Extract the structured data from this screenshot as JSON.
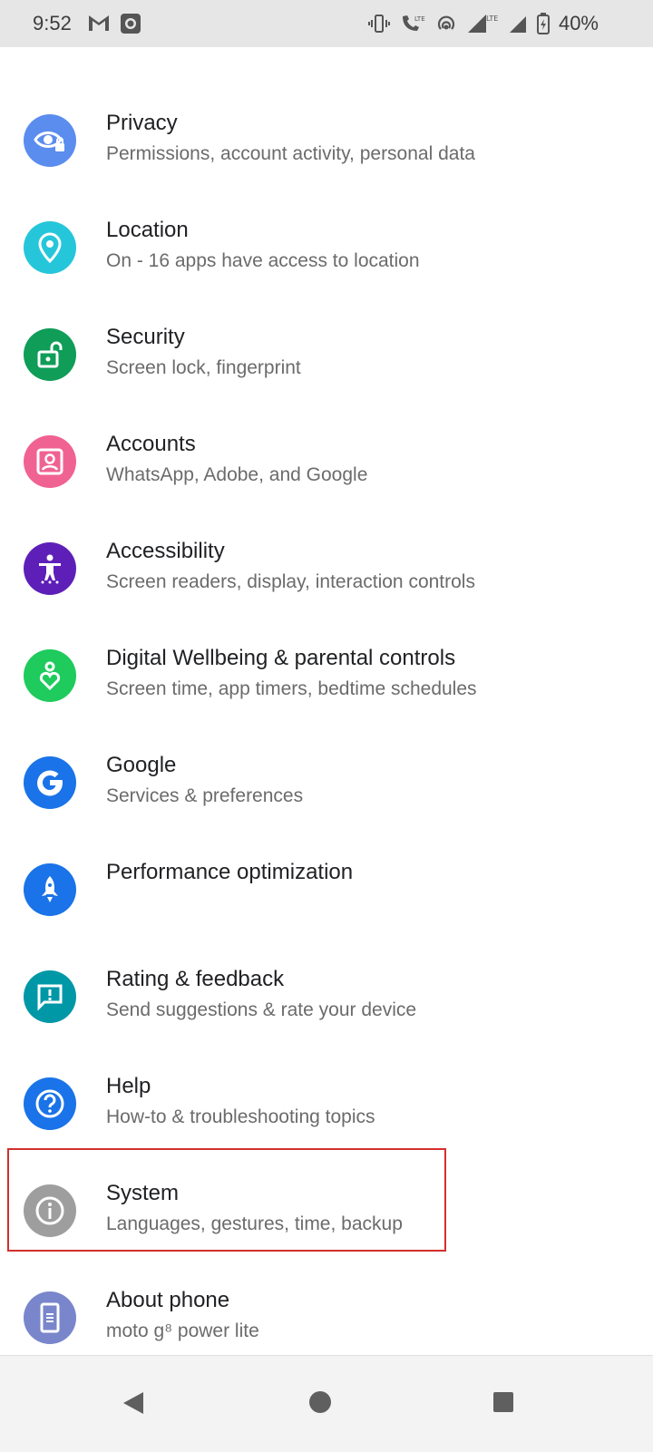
{
  "status_bar": {
    "time": "9:52",
    "battery": "40%"
  },
  "settings": [
    {
      "title": "Privacy",
      "subtitle": "Permissions, account activity, personal data",
      "icon": "privacy-eye-icon",
      "color": "#5b8def"
    },
    {
      "title": "Location",
      "subtitle": "On - 16 apps have access to location",
      "icon": "location-pin-icon",
      "color": "#26c6da"
    },
    {
      "title": "Security",
      "subtitle": "Screen lock, fingerprint",
      "icon": "lock-open-icon",
      "color": "#0f9d58"
    },
    {
      "title": "Accounts",
      "subtitle": "WhatsApp, Adobe, and Google",
      "icon": "account-box-icon",
      "color": "#f06292"
    },
    {
      "title": "Accessibility",
      "subtitle": "Screen readers, display, interaction controls",
      "icon": "accessibility-icon",
      "color": "#5e1fb8"
    },
    {
      "title": "Digital Wellbeing & parental controls",
      "subtitle": "Screen time, app timers, bedtime schedules",
      "icon": "wellbeing-heart-icon",
      "color": "#1ecb5c"
    },
    {
      "title": "Google",
      "subtitle": "Services & preferences",
      "icon": "google-g-icon",
      "color": "#1a73e8"
    },
    {
      "title": "Performance optimization",
      "subtitle": "",
      "icon": "rocket-icon",
      "color": "#1a73e8"
    },
    {
      "title": "Rating & feedback",
      "subtitle": "Send suggestions & rate your device",
      "icon": "feedback-icon",
      "color": "#0097a7"
    },
    {
      "title": "Help",
      "subtitle": "How-to & troubleshooting topics",
      "icon": "help-icon",
      "color": "#1a73e8"
    },
    {
      "title": "System",
      "subtitle": "Languages, gestures, time, backup",
      "icon": "info-icon",
      "color": "#9e9e9e"
    },
    {
      "title": "About phone",
      "subtitle": "moto g⁸ power lite",
      "icon": "phone-icon",
      "color": "#7986cb"
    }
  ]
}
